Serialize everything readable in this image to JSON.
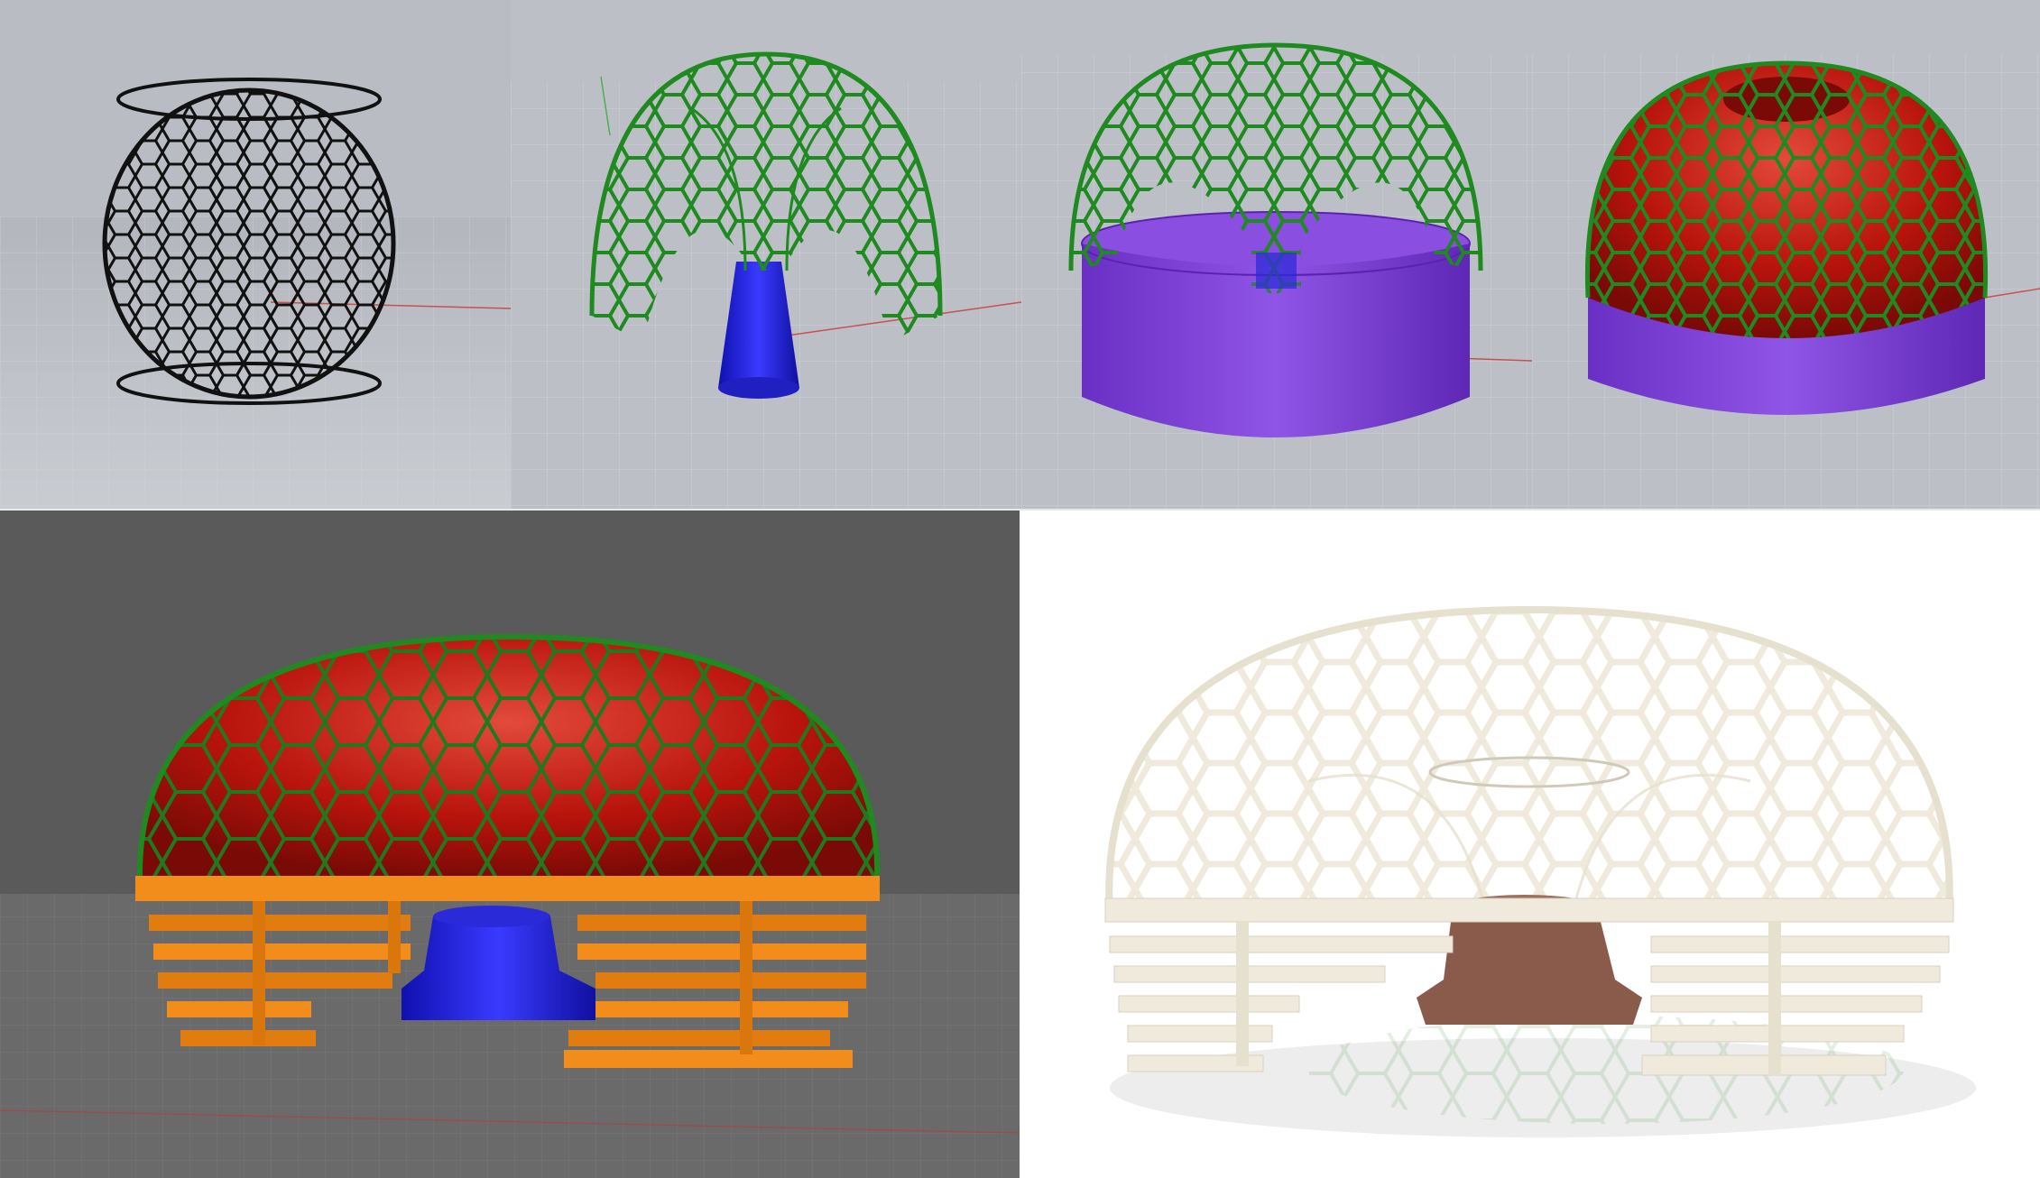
{
  "panels": [
    {
      "id": "p1",
      "caption": "",
      "accent": "#111111"
    },
    {
      "id": "p2",
      "caption": "",
      "accent": "#1f8a1f"
    },
    {
      "id": "p3",
      "caption": "",
      "accent": "#7a3fd6"
    },
    {
      "id": "p4",
      "caption": "",
      "accent": "#c21a10"
    },
    {
      "id": "p5",
      "caption": "",
      "accent": "#f28c1a"
    },
    {
      "id": "p6",
      "caption": "",
      "accent": "#efeadb"
    }
  ],
  "colors": {
    "viewport_light": "#b9bdc3",
    "viewport_dark": "#5a5a5a",
    "grid": "#d0d3d8",
    "lattice_black": "#111111",
    "lattice_green": "#1f8a1f",
    "column_blue": "#1d1de0",
    "base_purple": "#7a3fd6",
    "shell_red": "#c21a10",
    "slats_orange": "#f28c1a",
    "render_white": "#efeadb",
    "seat_brown": "#8a5a4a"
  }
}
